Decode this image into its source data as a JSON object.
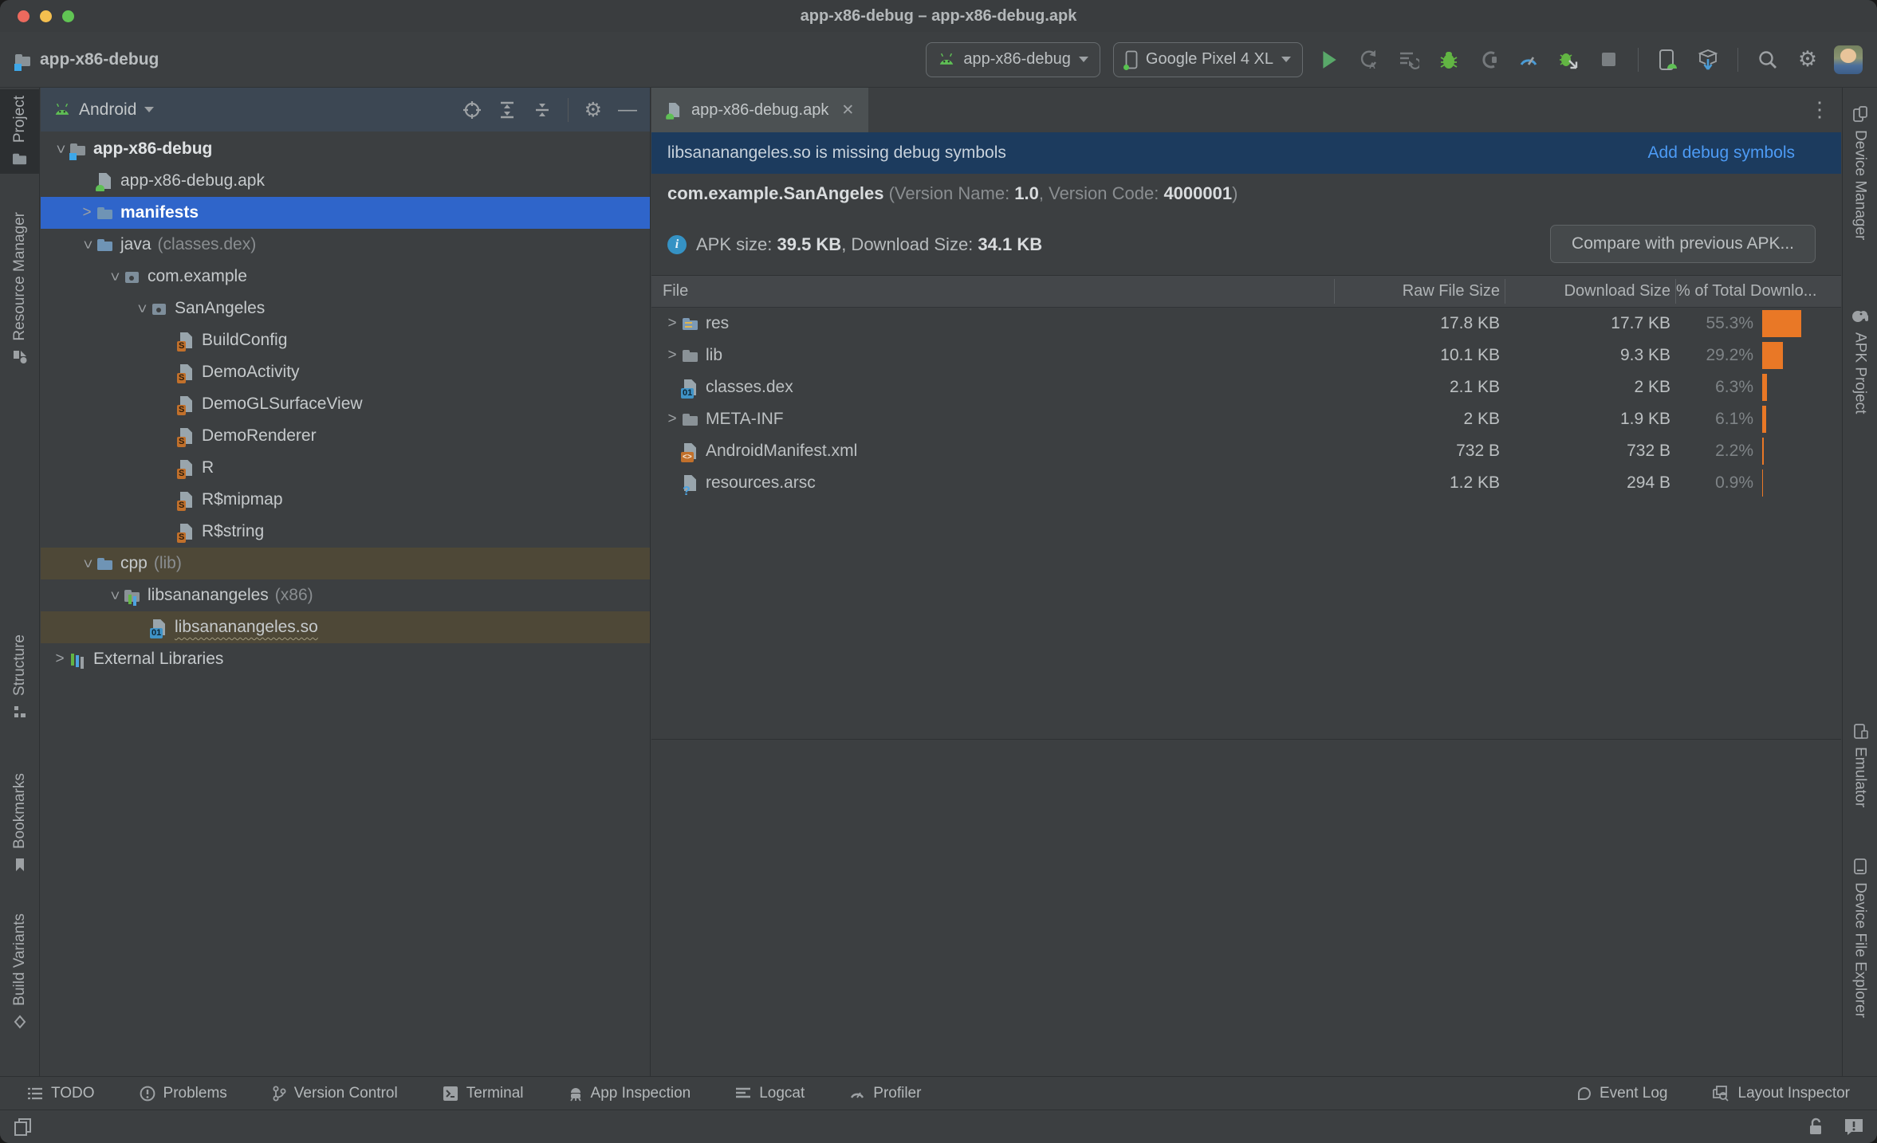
{
  "colors": {
    "selection_blue": "#2f65ca",
    "bar_orange": "#e97826",
    "banner_blue": "#1c3b5e",
    "link_blue": "#4d9bf5",
    "highlight_olive": "#4e4837",
    "android_green": "#5fbf55"
  },
  "titlebar": {
    "title": "app-x86-debug – app-x86-debug.apk"
  },
  "toolbar": {
    "project_name": "app-x86-debug",
    "run_config": "app-x86-debug",
    "device": "Google Pixel 4 XL"
  },
  "left_stripe": {
    "items": [
      {
        "label": "Project"
      },
      {
        "label": "Resource Manager"
      },
      {
        "label": "Structure"
      },
      {
        "label": "Bookmarks"
      },
      {
        "label": "Build Variants"
      }
    ]
  },
  "right_stripe": {
    "items": [
      {
        "label": "Device Manager"
      },
      {
        "label": "APK Project"
      },
      {
        "label": "Emulator"
      },
      {
        "label": "Device File Explorer"
      }
    ]
  },
  "project_panel": {
    "view_label": "Android",
    "tree": [
      {
        "label": "app-x86-debug",
        "annotation": ""
      },
      {
        "label": "app-x86-debug.apk",
        "annotation": ""
      },
      {
        "label": "manifests",
        "annotation": ""
      },
      {
        "label": "java",
        "annotation": "(classes.dex)"
      },
      {
        "label": "com.example",
        "annotation": ""
      },
      {
        "label": "SanAngeles",
        "annotation": ""
      },
      {
        "label": "BuildConfig",
        "annotation": ""
      },
      {
        "label": "DemoActivity",
        "annotation": ""
      },
      {
        "label": "DemoGLSurfaceView",
        "annotation": ""
      },
      {
        "label": "DemoRenderer",
        "annotation": ""
      },
      {
        "label": "R",
        "annotation": ""
      },
      {
        "label": "R$mipmap",
        "annotation": ""
      },
      {
        "label": "R$string",
        "annotation": ""
      },
      {
        "label": "cpp",
        "annotation": "(lib)"
      },
      {
        "label": "libsananangeles",
        "annotation": "(x86)"
      },
      {
        "label": "libsananangeles.so",
        "annotation": ""
      },
      {
        "label": "External Libraries",
        "annotation": ""
      }
    ]
  },
  "editor": {
    "tab_label": "app-x86-debug.apk",
    "banner": {
      "message": "libsananangeles.so is missing debug symbols",
      "action": "Add debug symbols"
    },
    "app_line": {
      "package": "com.example.SanAngeles",
      "label_open": " (Version Name: ",
      "version_name": "1.0",
      "label_mid": ", Version Code: ",
      "version_code": "4000001",
      "label_close": ")"
    },
    "apk_info": {
      "label": "APK size: ",
      "size": "39.5 KB",
      "download_label": ", Download Size: ",
      "download_size": "34.1 KB"
    },
    "compare_button": "Compare with previous APK...",
    "table": {
      "columns": [
        "File",
        "Raw File Size",
        "Download Size",
        "% of Total Downlo..."
      ],
      "rows": [
        {
          "name": "res",
          "raw": "17.8 KB",
          "download": "17.7 KB",
          "percent": "55.3%",
          "bar": 49
        },
        {
          "name": "lib",
          "raw": "10.1 KB",
          "download": "9.3 KB",
          "percent": "29.2%",
          "bar": 26
        },
        {
          "name": "classes.dex",
          "raw": "2.1 KB",
          "download": "2 KB",
          "percent": "6.3%",
          "bar": 6
        },
        {
          "name": "META-INF",
          "raw": "2 KB",
          "download": "1.9 KB",
          "percent": "6.1%",
          "bar": 5
        },
        {
          "name": "AndroidManifest.xml",
          "raw": "732 B",
          "download": "732 B",
          "percent": "2.2%",
          "bar": 2
        },
        {
          "name": "resources.arsc",
          "raw": "1.2 KB",
          "download": "294 B",
          "percent": "0.9%",
          "bar": 1
        }
      ]
    }
  },
  "bottom_bar": {
    "left": [
      {
        "label": "TODO"
      },
      {
        "label": "Problems"
      },
      {
        "label": "Version Control"
      },
      {
        "label": "Terminal"
      },
      {
        "label": "App Inspection"
      },
      {
        "label": "Logcat"
      },
      {
        "label": "Profiler"
      }
    ],
    "right": [
      {
        "label": "Event Log"
      },
      {
        "label": "Layout Inspector"
      }
    ]
  }
}
